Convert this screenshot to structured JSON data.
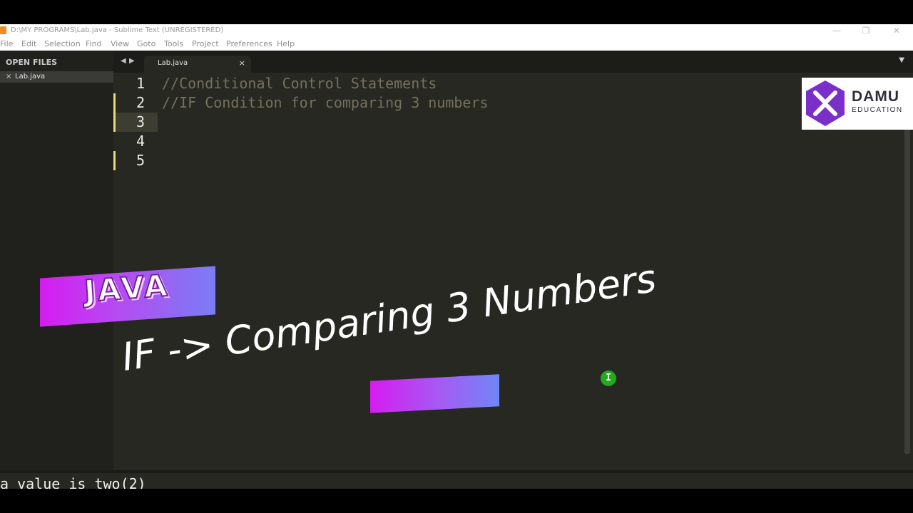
{
  "window": {
    "title": "D:\\MY PROGRAMS\\Lab.java - Sublime Text (UNREGISTERED)",
    "minimize_glyph": "—",
    "restore_glyph": "❐",
    "close_glyph": "✕"
  },
  "menu": [
    "File",
    "Edit",
    "Selection",
    "Find",
    "View",
    "Goto",
    "Tools",
    "Project",
    "Preferences",
    "Help"
  ],
  "sidebar": {
    "header": "OPEN FILES",
    "file": {
      "close_glyph": "×",
      "name": "Lab.java"
    }
  },
  "tabs": {
    "nav_left": "◀",
    "nav_right": "▶",
    "active": {
      "label": "Lab.java",
      "close_glyph": "×"
    },
    "dropdown_glyph": "▼"
  },
  "editor": {
    "lines": [
      {
        "num": "1",
        "text": "//Conditional Control Statements"
      },
      {
        "num": "2",
        "text": "//IF Condition for comparing 3 numbers"
      },
      {
        "num": "3",
        "text": ""
      },
      {
        "num": "4",
        "text": ""
      },
      {
        "num": "5",
        "text": ""
      }
    ]
  },
  "logo": {
    "line1": "DAMU",
    "line2": "EDUCATION"
  },
  "overlay": {
    "badge": "JAVA",
    "headline": "IF -> Comparing 3 Numbers",
    "cursor_glyph": "I"
  },
  "console": {
    "text": "a value is two(2)"
  },
  "colors": {
    "editor_bg": "#272822",
    "comment": "#75715e",
    "modified_marker": "#e6db74",
    "badge_gradient_start": "#d51cf0",
    "badge_gradient_end": "#7a7cf4",
    "logo_purple": "#7b2fc9",
    "cursor_green": "#23a821"
  }
}
